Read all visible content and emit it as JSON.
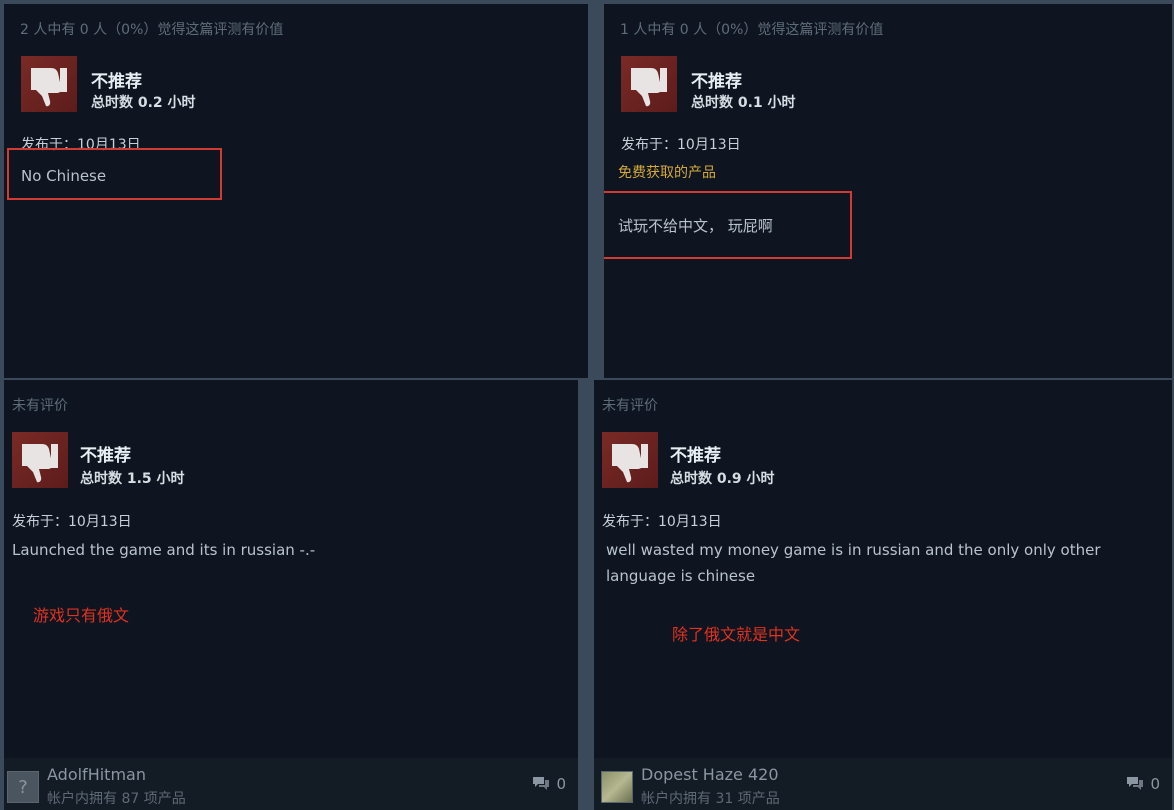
{
  "reviews": [
    {
      "helpful": "2 人中有 0 人（0%）觉得这篇评测有价值",
      "verdict": "不推荐",
      "hours": "总时数 0.2 小时",
      "posted": "发布于：10月13日",
      "body": "No Chinese"
    },
    {
      "helpful": "1 人中有 0 人（0%）觉得这篇评测有价值",
      "verdict": "不推荐",
      "hours": "总时数 0.1 小时",
      "posted": "发布于：10月13日",
      "free_label": "免费获取的产品",
      "body": "试玩不给中文， 玩屁啊"
    },
    {
      "helpful": "未有评价",
      "verdict": "不推荐",
      "hours": "总时数 1.5 小时",
      "posted": "发布于：10月13日",
      "body": "Launched the game and its in russian -.-",
      "annotation": "游戏只有俄文",
      "author": "AdolfHitman",
      "owned": "帐户内拥有 87 项产品",
      "comments": "0"
    },
    {
      "helpful": "未有评价",
      "verdict": "不推荐",
      "hours": "总时数 0.9 小时",
      "posted": "发布于：10月13日",
      "body": "well wasted my money game is in russian and the only only other language is chinese",
      "annotation": "除了俄文就是中文",
      "author": "Dopest Haze 420",
      "owned": "帐户内拥有 31 项产品",
      "comments": "0"
    }
  ],
  "icons": {
    "thumb": "thumbs-down-icon",
    "comment": "comment-bubble-icon",
    "avatar_placeholder": "?"
  },
  "colors": {
    "panel_bg": "#0e1520",
    "thumb_bg": "#6b2321",
    "highlight": "#d23b33",
    "annotation": "#e0321f",
    "free_label": "#d4a93a"
  }
}
